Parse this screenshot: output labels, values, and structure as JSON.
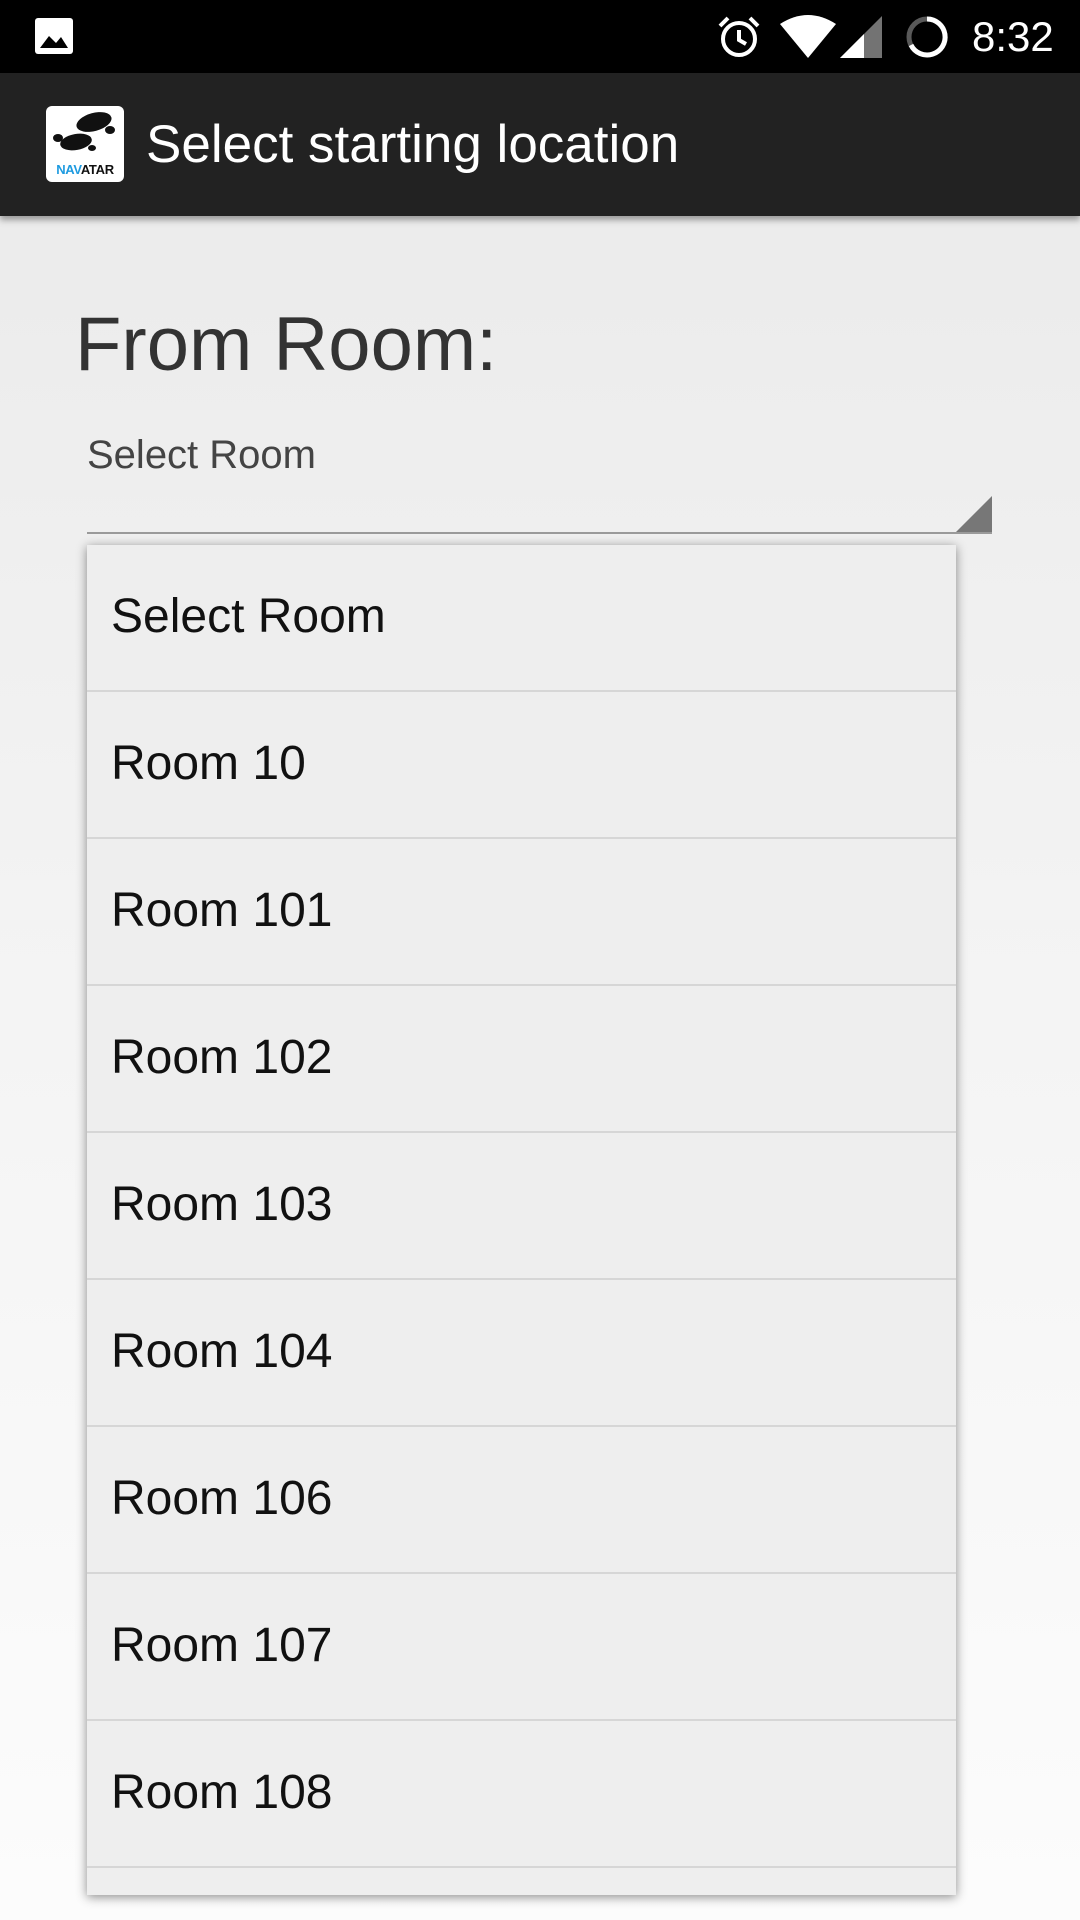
{
  "status_bar": {
    "time": "8:32",
    "icons": [
      "gallery-icon",
      "alarm-icon",
      "wifi-icon",
      "signal-icon",
      "battery-loading-icon"
    ]
  },
  "action_bar": {
    "logo_text_nav": "NAV",
    "logo_text_atar": "ATAR",
    "title": "Select starting location"
  },
  "form": {
    "from_label": "From Room:",
    "spinner_value": "Select Room"
  },
  "dropdown": {
    "items": [
      "Select Room",
      "Room 10",
      "Room 101",
      "Room 102",
      "Room 103",
      "Room 104",
      "Room 106",
      "Room 107",
      "Room 108"
    ]
  },
  "colors": {
    "status_bar": "#000000",
    "action_bar": "#222222",
    "dropdown_bg": "#eeeeee",
    "logo_accent": "#1e9be0"
  }
}
